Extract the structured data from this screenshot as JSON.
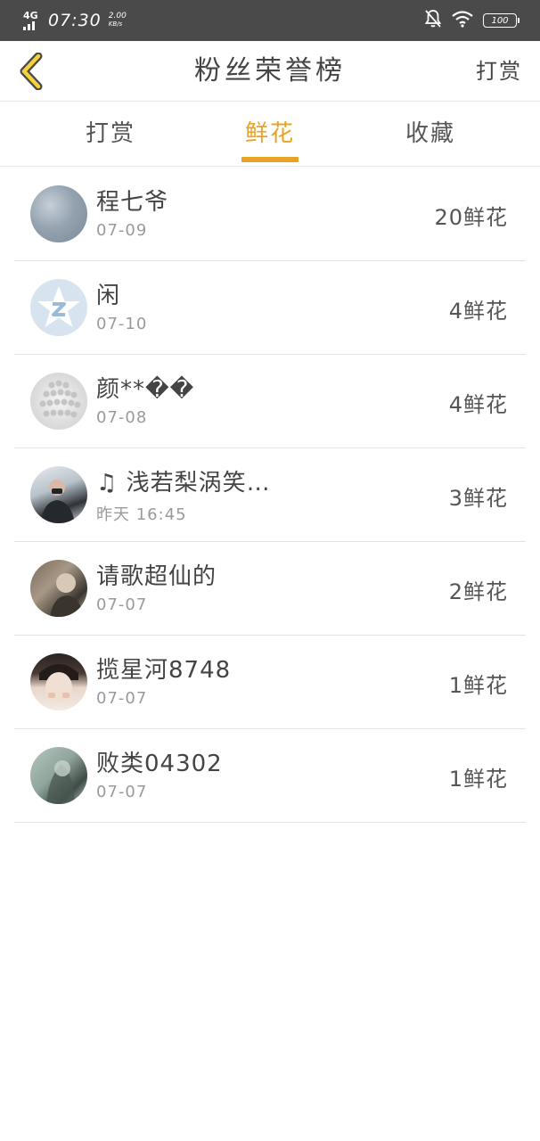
{
  "status_bar": {
    "network": "4G",
    "time": "07:30",
    "speed_value": "2.00",
    "speed_unit": "KB/s",
    "battery": "100"
  },
  "header": {
    "title": "粉丝荣誉榜",
    "action_label": "打赏"
  },
  "tabs": [
    {
      "label": "打赏",
      "active": false
    },
    {
      "label": "鲜花",
      "active": true
    },
    {
      "label": "收藏",
      "active": false
    }
  ],
  "list": [
    {
      "name": "程七爷",
      "date": "07-09",
      "amount": "20鲜花"
    },
    {
      "name": "闲",
      "date": "07-10",
      "amount": "4鲜花"
    },
    {
      "name": "颜**��",
      "date": "07-08",
      "amount": "4鲜花"
    },
    {
      "name": "♫ 浅若梨涡笑…",
      "date": "昨天 16:45",
      "amount": "3鲜花"
    },
    {
      "name": "请歌超仙的",
      "date": "07-07",
      "amount": "2鲜花"
    },
    {
      "name": "揽星河8748",
      "date": "07-07",
      "amount": "1鲜花"
    },
    {
      "name": "败类04302",
      "date": "07-07",
      "amount": "1鲜花"
    }
  ],
  "colors": {
    "accent": "#e8a323",
    "status_bar_bg": "#4a4a4a",
    "divider": "#e2e2e2"
  }
}
